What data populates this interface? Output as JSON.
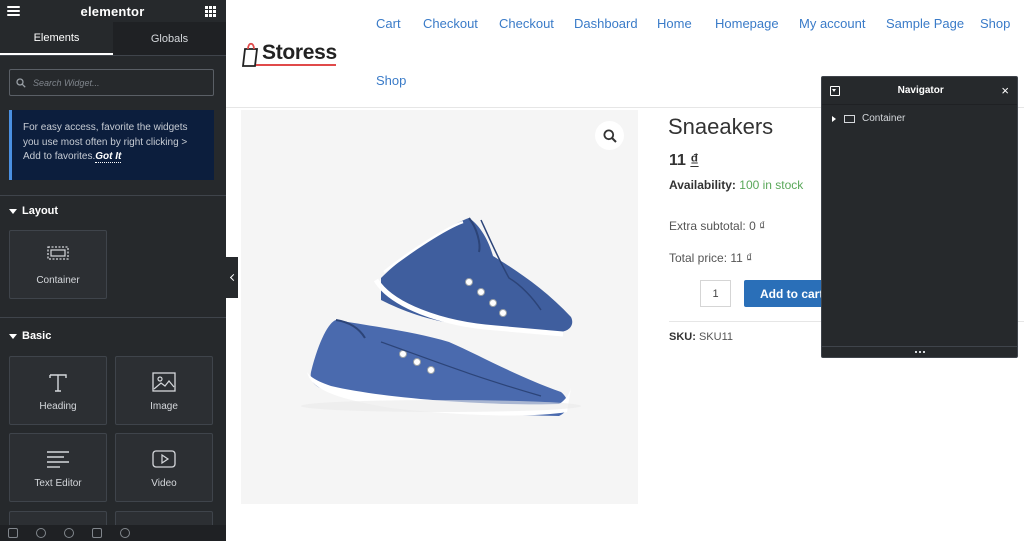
{
  "colors": {
    "panel_bg": "#26292c",
    "link": "#3a7bc8",
    "button": "#2a6fb8",
    "stock": "#5aa85a",
    "notice_bg": "#0c1e3d"
  },
  "panel": {
    "brand": "elementor",
    "menu_icon": "hamburger-icon",
    "apps_icon": "grid-icon",
    "tabs": [
      {
        "label": "Elements",
        "active": true
      },
      {
        "label": "Globals",
        "active": false
      }
    ],
    "search": {
      "placeholder": "Search Widget...",
      "value": ""
    },
    "notice": {
      "text": "For easy access, favorite the widgets you use most often by right clicking > Add to favorites.",
      "link": "Got It"
    },
    "sections": [
      {
        "title": "Layout",
        "widgets": [
          {
            "label": "Container",
            "icon": "container-icon"
          }
        ]
      },
      {
        "title": "Basic",
        "widgets": [
          {
            "label": "Heading",
            "icon": "heading-icon"
          },
          {
            "label": "Image",
            "icon": "image-icon"
          },
          {
            "label": "Text Editor",
            "icon": "text-editor-icon"
          },
          {
            "label": "Video",
            "icon": "video-icon"
          }
        ]
      }
    ]
  },
  "site": {
    "logo": "Storess",
    "nav": [
      "Cart",
      "Checkout",
      "Checkout",
      "Dashboard",
      "Home",
      "Homepage",
      "My account",
      "Sample Page",
      "Shop",
      "Shop"
    ]
  },
  "product": {
    "title": "Snaeakers",
    "price": "11",
    "currency": "₫",
    "availability_label": "Availability:",
    "availability_value": "100 in stock",
    "extra_label": "Extra subtotal:",
    "extra_value": "0 ₫",
    "total_label": "Total price:",
    "total_value": "11 ₫",
    "quantity": "1",
    "add_to_cart": "Add to cart",
    "sku_label": "SKU:",
    "sku_value": "SKU11"
  },
  "navigator": {
    "title": "Navigator",
    "close": "×",
    "items": [
      {
        "label": "Container"
      }
    ]
  }
}
